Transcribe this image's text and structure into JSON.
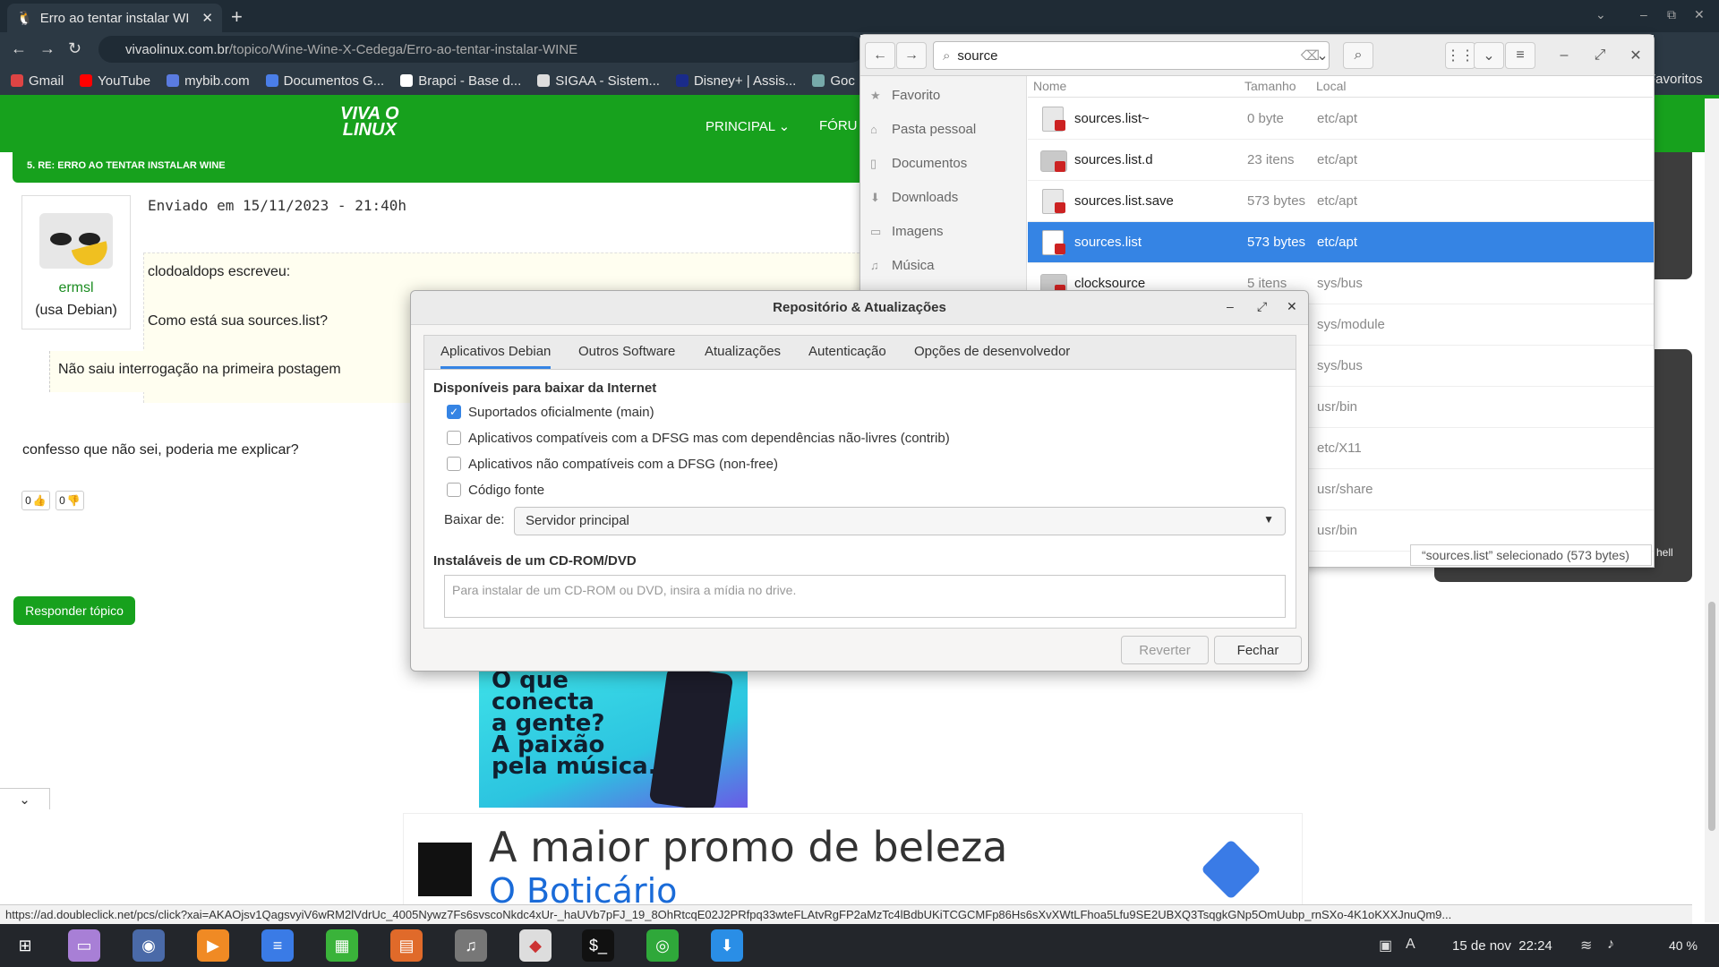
{
  "browser": {
    "tab_title": "Erro ao tentar instalar WI",
    "url_domain": "vivaolinux.com.br",
    "url_path": "/topico/Wine-Wine-X-Cedega/Erro-ao-tentar-instalar-WINE",
    "bookmarks": [
      "Gmail",
      "YouTube",
      "mybib.com",
      "Documentos G...",
      "Brapci - Base d...",
      "SIGAA - Sistem...",
      "Disney+ | Assis...",
      "Goc"
    ],
    "bookmarks_right": "Favoritos",
    "status_url": "https://ad.doubleclick.net/pcs/click?xai=AKAOjsv1QagsvyiV6wRM2lVdrUc_4005Nywz7Fs6svscoNkdc4xUr-_haUVb7pFJ_19_8OhRtcqE02J2PRfpq33wteFLAtvRgFP2aMzTc4lBdbUKiTCGCMFp86Hs6sXvXWtLFhoa5Lfu9SE2UBXQ3TsqgkGNp5OmUubp_rnSXo-4K1oKXXJnuQm9..."
  },
  "site": {
    "logo_line1": "VIVA O",
    "logo_line2": "LINUX",
    "menu_principal": "PRINCIPAL ⌄",
    "menu_forum": "FÓRU",
    "post_header": "5. RE: ERRO AO TENTAR INSTALAR WINE",
    "sent": "Enviado em 15/11/2023 - 21:40h",
    "username": "ermsl",
    "user_dist": "(usa Debian)",
    "quote_author": "clodoaldops escreveu:",
    "quote_question": "Como está sua sources.list?",
    "inner_quote": "Não saiu interrogação na primeira postagem",
    "reply": "confesso que não sei, poderia me explicar?",
    "vote_up": "0",
    "vote_down": "0",
    "reply_button": "Responder tópico",
    "ad_text": "O que\nconecta\na gente?\nA paixão\npela música.",
    "bottom_ad_title": "A maior promo de beleza",
    "bottom_ad_brand": "O Boticário"
  },
  "nautilus": {
    "search": "source",
    "sidebar": [
      "Favorito",
      "Pasta pessoal",
      "Documentos",
      "Downloads",
      "Imagens",
      "Música"
    ],
    "columns": {
      "name": "Nome",
      "size": "Tamanho",
      "location": "Local"
    },
    "files": [
      {
        "name": "sources.list~",
        "size": "0 byte",
        "loc": "etc/apt"
      },
      {
        "name": "sources.list.d",
        "size": "23 itens",
        "loc": "etc/apt"
      },
      {
        "name": "sources.list.save",
        "size": "573 bytes",
        "loc": "etc/apt"
      },
      {
        "name": "sources.list",
        "size": "573 bytes",
        "loc": "etc/apt"
      },
      {
        "name": "clocksource",
        "size": "5 itens",
        "loc": "sys/bus"
      },
      {
        "name": "",
        "size": "",
        "loc": "sys/module"
      },
      {
        "name": "",
        "size": "",
        "loc": "sys/bus"
      },
      {
        "name": "",
        "size": "",
        "loc": "usr/bin"
      },
      {
        "name": "",
        "size": "",
        "loc": "etc/X11"
      },
      {
        "name": "",
        "size": "",
        "loc": "usr/share"
      },
      {
        "name": "",
        "size": "",
        "loc": "usr/bin"
      }
    ],
    "status": "“sources.list” selecionado  (573 bytes)",
    "peek_text": "hell"
  },
  "dialog": {
    "title": "Repositório & Atualizações",
    "tabs": [
      "Aplicativos Debian",
      "Outros Software",
      "Atualizações",
      "Autenticação",
      "Opções de desenvolvedor"
    ],
    "section1": "Disponíveis para baixar da Internet",
    "options": [
      {
        "label": "Suportados oficialmente (main)",
        "checked": true
      },
      {
        "label": "Aplicativos compatíveis com a DFSG mas com dependências não-livres (contrib)",
        "checked": false
      },
      {
        "label": "Aplicativos não compatíveis com a DFSG (non-free)",
        "checked": false
      },
      {
        "label": "Código fonte",
        "checked": false
      }
    ],
    "download_label": "Baixar de:",
    "download_value": "Servidor principal",
    "section2": "Instaláveis de um CD-ROM/DVD",
    "cd_hint": "Para instalar de um CD-ROM ou DVD, insira a mídia no drive.",
    "revert": "Reverter",
    "close": "Fechar"
  },
  "taskbar": {
    "date": "15 de nov",
    "time": "22:24",
    "battery": "40 %"
  }
}
